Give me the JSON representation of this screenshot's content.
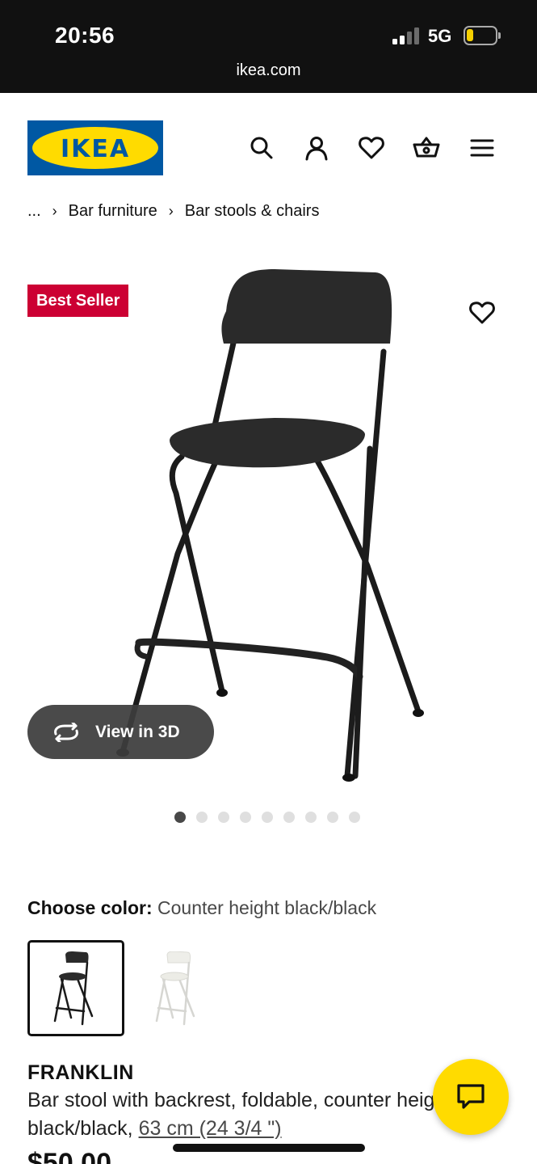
{
  "status": {
    "time": "20:56",
    "network": "5G",
    "url": "ikea.com"
  },
  "header": {
    "logo_text": "IKEA",
    "icons": [
      "search-icon",
      "account-icon",
      "heart-icon",
      "basket-icon",
      "menu-icon"
    ]
  },
  "breadcrumb": {
    "ellipsis": "...",
    "items": [
      "Bar furniture",
      "Bar stools & chairs"
    ]
  },
  "gallery": {
    "badge": "Best Seller",
    "view3d_label": "View in 3D",
    "image_count": 9,
    "active_index": 0
  },
  "color": {
    "label": "Choose color:",
    "value": "Counter height black/black",
    "options": [
      "black",
      "white"
    ],
    "selected": 0
  },
  "product": {
    "name": "FRANKLIN",
    "desc_prefix": "Bar stool with backrest, foldable, counter height black/black, ",
    "size_link": "63 cm (24 3/4 \")",
    "price": "$50.00"
  },
  "colors": {
    "brand_blue": "#0058a3",
    "brand_yellow": "#ffdb00",
    "badge_red": "#cc0033"
  }
}
